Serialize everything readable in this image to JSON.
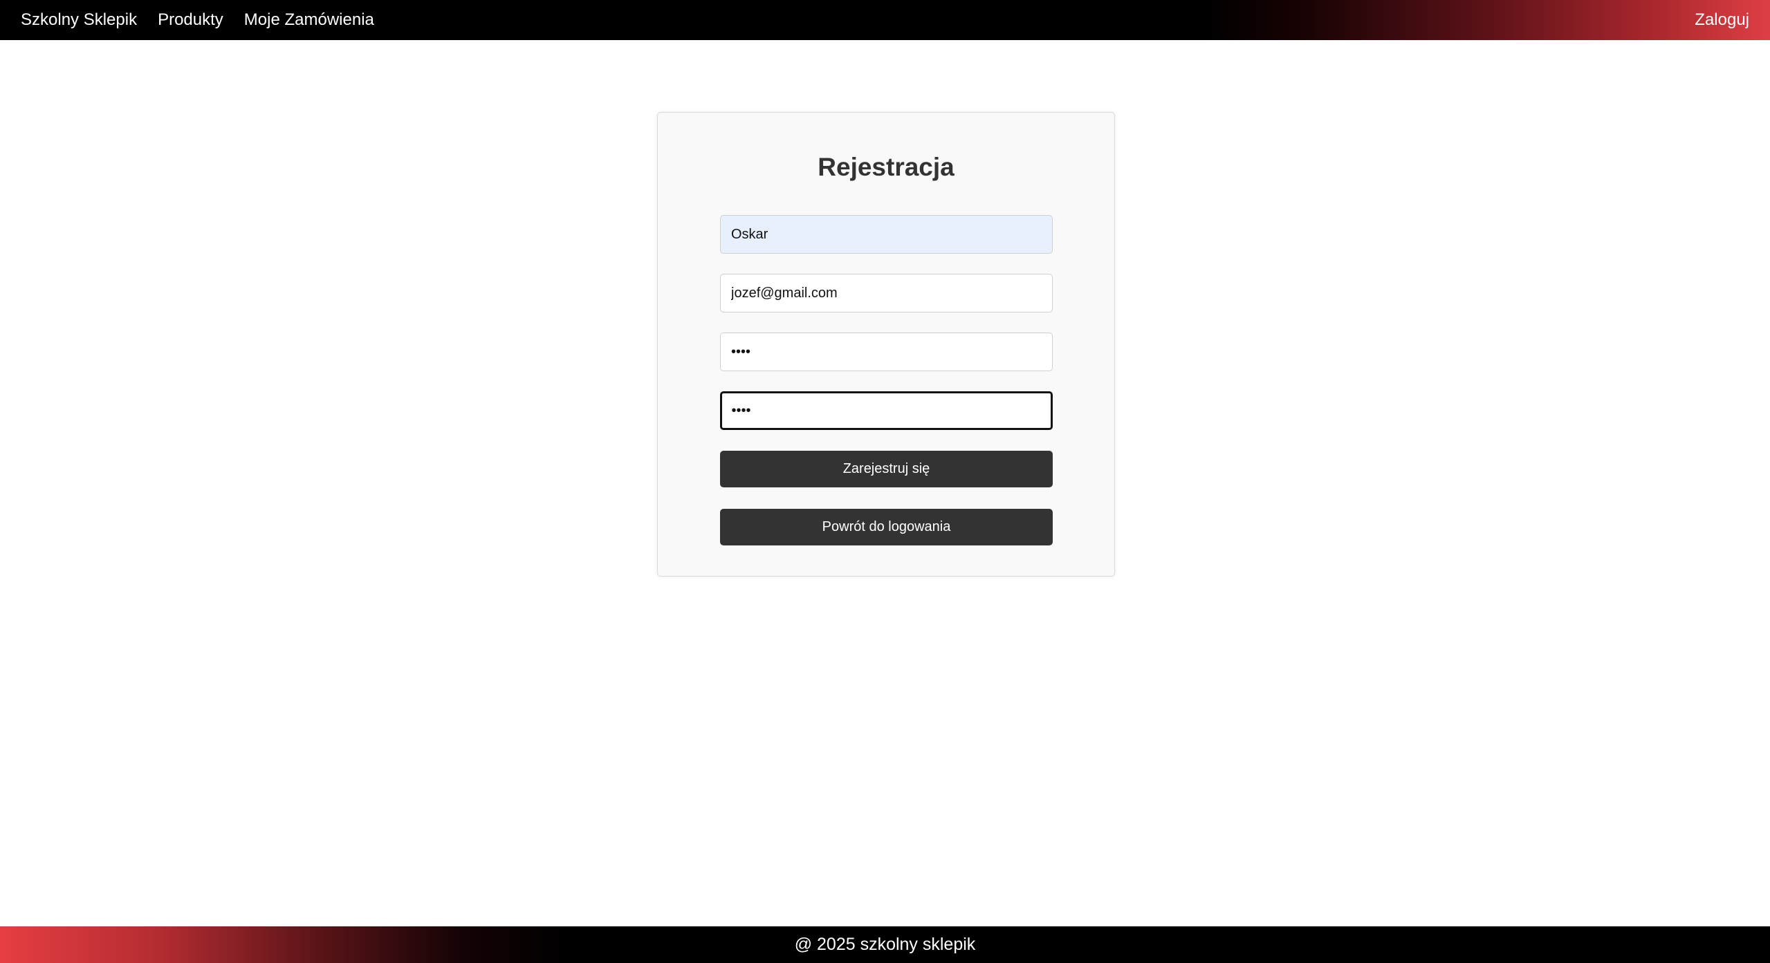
{
  "navbar": {
    "brand": "Szkolny Sklepik",
    "links": [
      "Produkty",
      "Moje Zamówienia"
    ],
    "login": "Zaloguj"
  },
  "form": {
    "title": "Rejestracja",
    "username_value": "Oskar",
    "email_value": "jozef@gmail.com",
    "password_value": "••••",
    "confirm_password_value": "••••",
    "register_button": "Zarejestruj się",
    "back_button": "Powrót do logowania"
  },
  "footer": {
    "text": "@ 2025 szkolny sklepik"
  },
  "colors": {
    "nav_gradient_end": "#de3f44",
    "button_bg": "#333333",
    "card_bg": "#f9f9f9",
    "autofill_bg": "#e8f0fe"
  }
}
